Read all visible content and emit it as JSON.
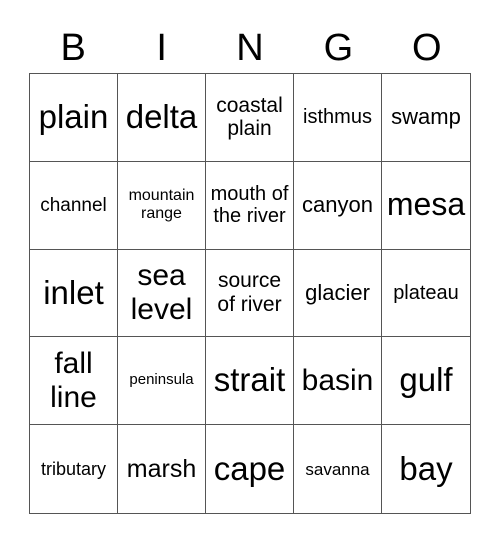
{
  "header": [
    "B",
    "I",
    "N",
    "G",
    "O"
  ],
  "cells": [
    {
      "text": "plain",
      "size": 33
    },
    {
      "text": "delta",
      "size": 33
    },
    {
      "text": "coastal plain",
      "size": 21
    },
    {
      "text": "isthmus",
      "size": 20
    },
    {
      "text": "swamp",
      "size": 22
    },
    {
      "text": "channel",
      "size": 19
    },
    {
      "text": "mountain range",
      "size": 16
    },
    {
      "text": "mouth of the river",
      "size": 20
    },
    {
      "text": "canyon",
      "size": 22
    },
    {
      "text": "mesa",
      "size": 32
    },
    {
      "text": "inlet",
      "size": 33
    },
    {
      "text": "sea level",
      "size": 30
    },
    {
      "text": "source of river",
      "size": 21
    },
    {
      "text": "glacier",
      "size": 22
    },
    {
      "text": "plateau",
      "size": 20
    },
    {
      "text": "fall line",
      "size": 30
    },
    {
      "text": "peninsula",
      "size": 15
    },
    {
      "text": "strait",
      "size": 33
    },
    {
      "text": "basin",
      "size": 30
    },
    {
      "text": "gulf",
      "size": 33
    },
    {
      "text": "tributary",
      "size": 18
    },
    {
      "text": "marsh",
      "size": 25
    },
    {
      "text": "cape",
      "size": 33
    },
    {
      "text": "savanna",
      "size": 17
    },
    {
      "text": "bay",
      "size": 33
    }
  ]
}
